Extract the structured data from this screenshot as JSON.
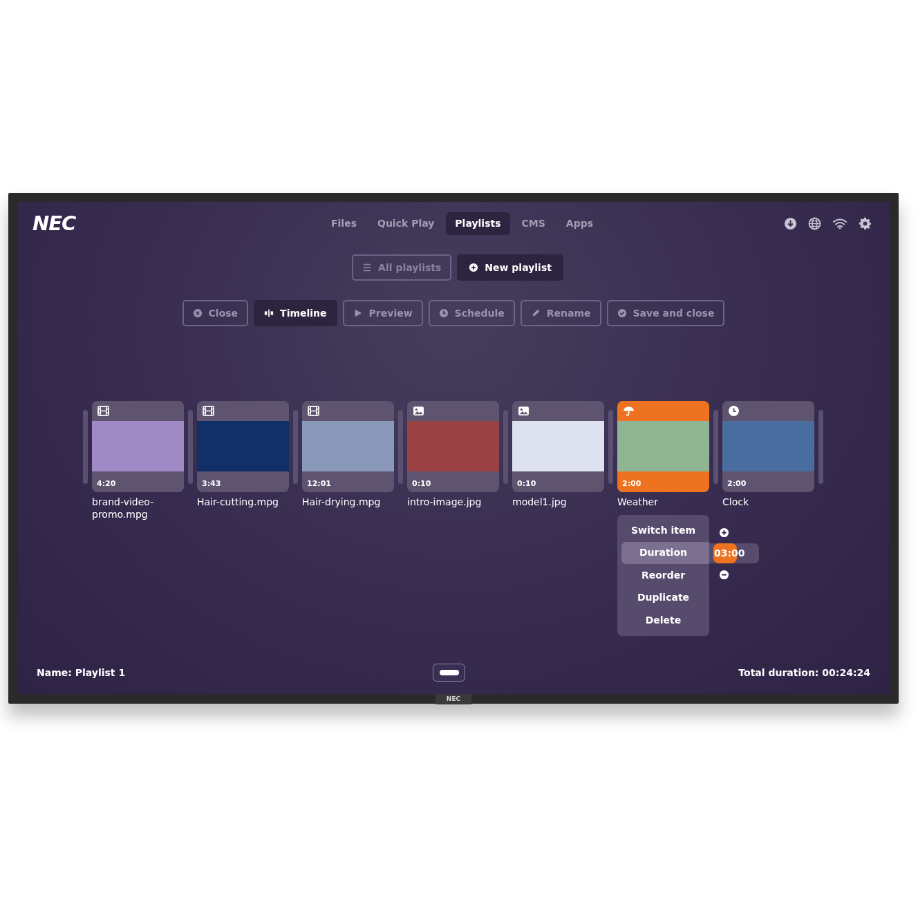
{
  "logo": "NEC",
  "nav": [
    {
      "label": "Files",
      "selected": false
    },
    {
      "label": "Quick Play",
      "selected": false
    },
    {
      "label": "Playlists",
      "selected": true
    },
    {
      "label": "CMS",
      "selected": false
    },
    {
      "label": "Apps",
      "selected": false
    }
  ],
  "playlist_buttons": [
    {
      "label": "All playlists",
      "selected": false
    },
    {
      "label": "New playlist",
      "selected": true
    }
  ],
  "toolbar": [
    {
      "label": "Close",
      "selected": false
    },
    {
      "label": "Timeline",
      "selected": true
    },
    {
      "label": "Preview",
      "selected": false
    },
    {
      "label": "Schedule",
      "selected": false
    },
    {
      "label": "Rename",
      "selected": false
    },
    {
      "label": "Save and close",
      "selected": false
    }
  ],
  "items": [
    {
      "kind": "video",
      "name": "brand-video-promo.mpg",
      "duration": "4:20",
      "color": "#a08ac6",
      "selected": false
    },
    {
      "kind": "video",
      "name": "Hair-cutting.mpg",
      "duration": "3:43",
      "color": "#11306a",
      "selected": false
    },
    {
      "kind": "video",
      "name": "Hair-drying.mpg",
      "duration": "12:01",
      "color": "#8a98ba",
      "selected": false
    },
    {
      "kind": "image",
      "name": "intro-image.jpg",
      "duration": "0:10",
      "color": "#9a4244",
      "selected": false
    },
    {
      "kind": "image",
      "name": "model1.jpg",
      "duration": "0:10",
      "color": "#dde1f0",
      "selected": false
    },
    {
      "kind": "weather",
      "name": "Weather",
      "duration": "2:00",
      "color": "#90b592",
      "selected": true
    },
    {
      "kind": "clock",
      "name": "Clock",
      "duration": "2:00",
      "color": "#4a6da0",
      "selected": false
    }
  ],
  "context_menu": {
    "items": [
      {
        "label": "Switch item",
        "selected": false
      },
      {
        "label": "Duration",
        "selected": true
      },
      {
        "label": "Reorder",
        "selected": false
      },
      {
        "label": "Duplicate",
        "selected": false
      },
      {
        "label": "Delete",
        "selected": false
      }
    ],
    "duration_value": "03:00"
  },
  "footer": {
    "name": "Name: Playlist 1",
    "total_duration": "Total duration: 00:24:24"
  },
  "bezel_logo": "NEC"
}
